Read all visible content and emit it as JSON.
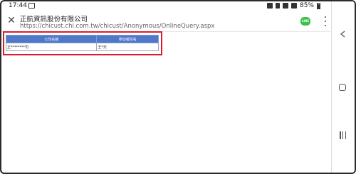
{
  "status_bar": {
    "time": "17:44",
    "battery": "85%",
    "icons": [
      "image-icon",
      "alarm-icon",
      "mute-icon",
      "wifi-icon",
      "signal-icon",
      "battery-icon"
    ]
  },
  "toolbar": {
    "title": "正航資訊股份有限公司",
    "url": "https://chicust.chi.com.tw/chicust/Anonymous/OnlineQuery.aspx",
    "line_label": "LINE",
    "close_icon": "close-icon",
    "menu_icon": "more-vert-icon"
  },
  "table": {
    "headers": [
      "公司名稱",
      "參加者姓名"
    ],
    "rows": [
      [
        "正********司",
        "王*天"
      ]
    ]
  },
  "nav": {
    "back_icon": "back-icon",
    "home_icon": "home-icon",
    "recent_icon": "recent-apps-icon"
  },
  "colors": {
    "table_header": "#4f78c8",
    "highlight": "#d81e2e",
    "line_green": "#3cc24a"
  }
}
